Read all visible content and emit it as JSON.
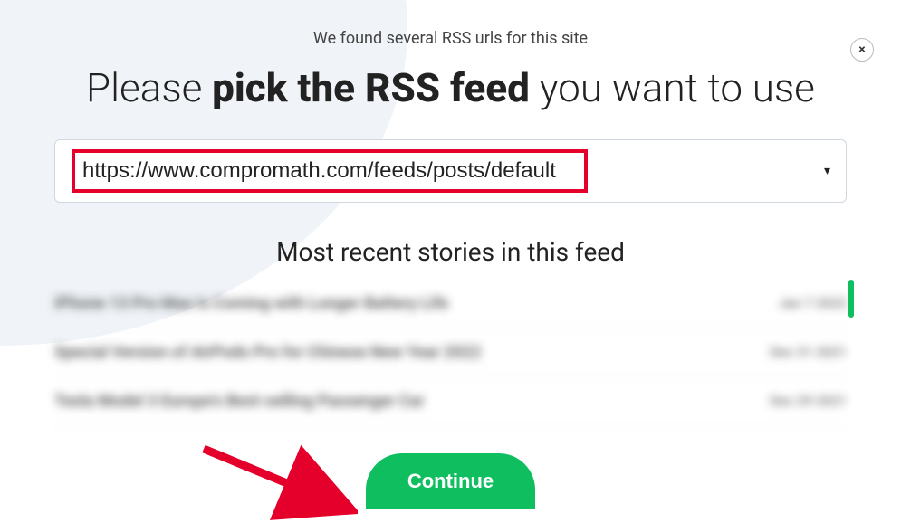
{
  "subtitle": "We found several RSS urls for this site",
  "title": {
    "pre": "Please ",
    "bold": "pick the RSS feed",
    "post": " you want to use"
  },
  "close_icon": "×",
  "select": {
    "value": "https://www.compromath.com/feeds/posts/default"
  },
  "feed_list_title": "Most recent stories in this feed",
  "feed_rows": [
    {
      "title": "iPhone 13 Pro Max is Coming with Longer Battery Life",
      "date": "Jan 7 2022"
    },
    {
      "title": "Special Version of AirPods Pro for Chinese New Year 2022",
      "date": "Dec 31 2021"
    },
    {
      "title": "Tesla Model 3 Europe's Best-selling Passenger Car",
      "date": "Dec 29 2021"
    }
  ],
  "continue_label": "Continue"
}
